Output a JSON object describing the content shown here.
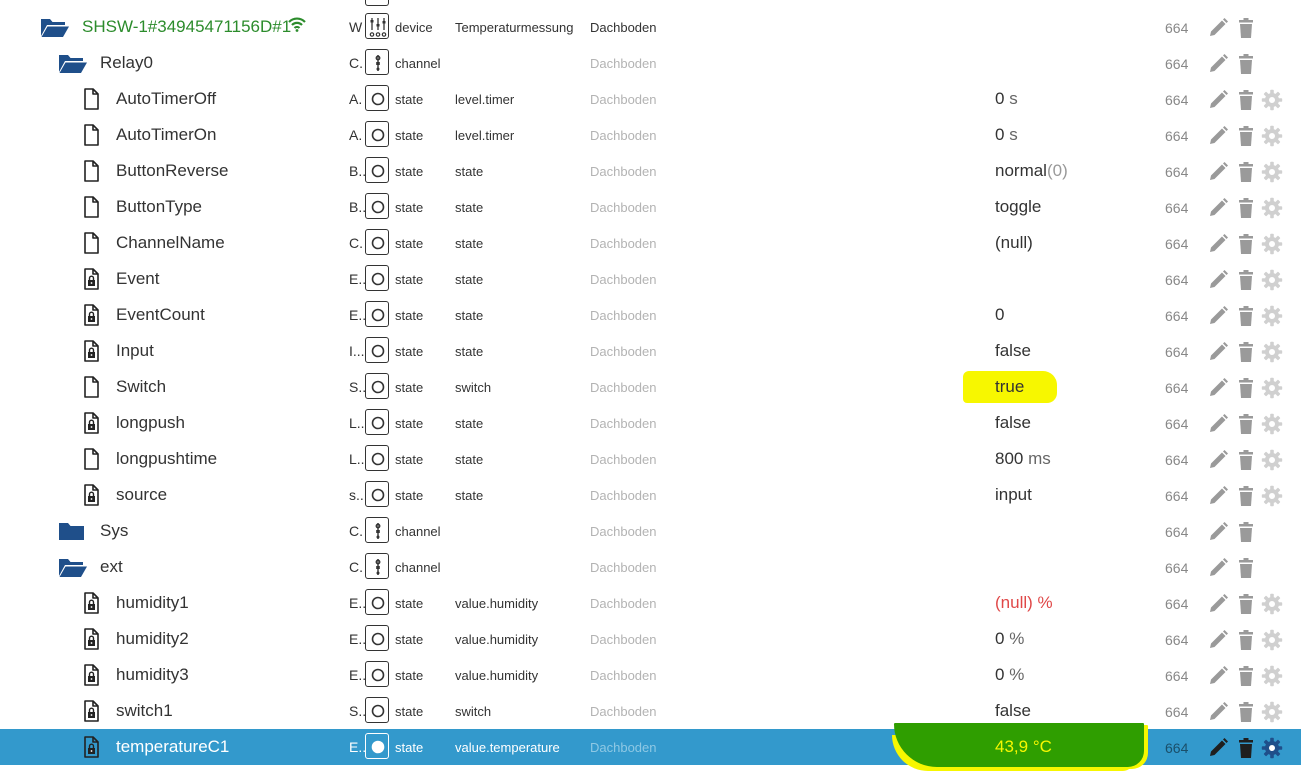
{
  "colors": {
    "folder": "#1f4f8a",
    "device_name": "#2c8c2c",
    "wifi": "#2c8c2c",
    "selected_row": "#3399cc",
    "error_value": "#e04848",
    "highlight_yellow": "#f7f700",
    "highlight_green": "#2f9e00",
    "action_icon": "#9a9a9a"
  },
  "rows": [
    {
      "icon": "folder-open-icon",
      "depth": 0,
      "name": "SHSW-1#34945471156D#1",
      "wifi": true,
      "role_abbr": "W",
      "type_icon": "device-icon",
      "type": "device",
      "role": "Temperaturmessung",
      "room": "Dachboden",
      "room_main": true,
      "value": "",
      "unit": "",
      "acl": "664",
      "gear": false
    },
    {
      "icon": "folder-open-icon",
      "depth": 1,
      "name": "Relay0",
      "role_abbr": "C.",
      "type_icon": "channel-icon",
      "type": "channel",
      "role": "",
      "room": "Dachboden",
      "value": "",
      "unit": "",
      "acl": "664",
      "gear": false
    },
    {
      "icon": "file-icon",
      "depth": 2,
      "name": "AutoTimerOff",
      "role_abbr": "A.",
      "type_icon": "state-icon",
      "type": "state",
      "role": "level.timer",
      "room": "Dachboden",
      "value": "0",
      "unit": " s",
      "acl": "664",
      "gear": true
    },
    {
      "icon": "file-icon",
      "depth": 2,
      "name": "AutoTimerOn",
      "role_abbr": "A.",
      "type_icon": "state-icon",
      "type": "state",
      "role": "level.timer",
      "room": "Dachboden",
      "value": "0",
      "unit": " s",
      "acl": "664",
      "gear": true
    },
    {
      "icon": "file-icon",
      "depth": 2,
      "name": "ButtonReverse",
      "role_abbr": "B..",
      "type_icon": "state-icon",
      "type": "state",
      "role": "state",
      "room": "Dachboden",
      "value": "normal",
      "unit": "(0)",
      "unit_paren": true,
      "acl": "664",
      "gear": true
    },
    {
      "icon": "file-icon",
      "depth": 2,
      "name": "ButtonType",
      "role_abbr": "B..",
      "type_icon": "state-icon",
      "type": "state",
      "role": "state",
      "room": "Dachboden",
      "value": "toggle",
      "unit": "",
      "acl": "664",
      "gear": true
    },
    {
      "icon": "file-icon",
      "depth": 2,
      "name": "ChannelName",
      "role_abbr": "C.",
      "type_icon": "state-icon",
      "type": "state",
      "role": "state",
      "room": "Dachboden",
      "value": "(null)",
      "unit": "",
      "acl": "664",
      "gear": true
    },
    {
      "icon": "file-lock-icon",
      "depth": 2,
      "name": "Event",
      "role_abbr": "E..",
      "type_icon": "state-icon",
      "type": "state",
      "role": "state",
      "room": "Dachboden",
      "value": "",
      "unit": "",
      "acl": "664",
      "gear": true
    },
    {
      "icon": "file-lock-icon",
      "depth": 2,
      "name": "EventCount",
      "role_abbr": "E..",
      "type_icon": "state-icon",
      "type": "state",
      "role": "state",
      "room": "Dachboden",
      "value": "0",
      "unit": "",
      "acl": "664",
      "gear": true
    },
    {
      "icon": "file-lock-icon",
      "depth": 2,
      "name": "Input",
      "role_abbr": "I...",
      "type_icon": "state-icon",
      "type": "state",
      "role": "state",
      "room": "Dachboden",
      "value": "false",
      "unit": "",
      "acl": "664",
      "gear": true
    },
    {
      "icon": "file-icon",
      "depth": 2,
      "name": "Switch",
      "role_abbr": "S..",
      "type_icon": "state-icon",
      "type": "state",
      "role": "switch",
      "room": "Dachboden",
      "value": "true",
      "unit": "",
      "highlight": "yellow",
      "acl": "664",
      "gear": true
    },
    {
      "icon": "file-lock-icon",
      "depth": 2,
      "name": "longpush",
      "role_abbr": "L..",
      "type_icon": "state-icon",
      "type": "state",
      "role": "state",
      "room": "Dachboden",
      "value": "false",
      "unit": "",
      "acl": "664",
      "gear": true
    },
    {
      "icon": "file-icon",
      "depth": 2,
      "name": "longpushtime",
      "role_abbr": "L..",
      "type_icon": "state-icon",
      "type": "state",
      "role": "state",
      "room": "Dachboden",
      "value": "800",
      "unit": " ms",
      "acl": "664",
      "gear": true
    },
    {
      "icon": "file-lock-icon",
      "depth": 2,
      "name": "source",
      "role_abbr": "s..",
      "type_icon": "state-icon",
      "type": "state",
      "role": "state",
      "room": "Dachboden",
      "value": "input",
      "unit": "",
      "acl": "664",
      "gear": true
    },
    {
      "icon": "folder-closed-icon",
      "depth": 1,
      "name": "Sys",
      "role_abbr": "C.",
      "type_icon": "channel-icon",
      "type": "channel",
      "role": "",
      "room": "Dachboden",
      "value": "",
      "unit": "",
      "acl": "664",
      "gear": false
    },
    {
      "icon": "folder-open-icon",
      "depth": 1,
      "name": "ext",
      "role_abbr": "C.",
      "type_icon": "channel-icon",
      "type": "channel",
      "role": "",
      "room": "Dachboden",
      "value": "",
      "unit": "",
      "acl": "664",
      "gear": false
    },
    {
      "icon": "file-lock-icon",
      "depth": 2,
      "name": "humidity1",
      "role_abbr": "E..",
      "type_icon": "state-icon",
      "type": "state",
      "role": "value.humidity",
      "room": "Dachboden",
      "value": "(null)",
      "unit": " %",
      "error": true,
      "acl": "664",
      "gear": true
    },
    {
      "icon": "file-lock-icon",
      "depth": 2,
      "name": "humidity2",
      "role_abbr": "E..",
      "type_icon": "state-icon",
      "type": "state",
      "role": "value.humidity",
      "room": "Dachboden",
      "value": "0",
      "unit": " %",
      "acl": "664",
      "gear": true
    },
    {
      "icon": "file-lock-icon",
      "depth": 2,
      "name": "humidity3",
      "role_abbr": "E..",
      "type_icon": "state-icon",
      "type": "state",
      "role": "value.humidity",
      "room": "Dachboden",
      "value": "0",
      "unit": " %",
      "acl": "664",
      "gear": true
    },
    {
      "icon": "file-lock-icon",
      "depth": 2,
      "name": "switch1",
      "role_abbr": "S..",
      "type_icon": "state-icon",
      "type": "state",
      "role": "switch",
      "room": "Dachboden",
      "value": "false",
      "unit": "",
      "acl": "664",
      "gear": true
    },
    {
      "icon": "file-lock-icon",
      "depth": 2,
      "name": "temperatureC1",
      "role_abbr": "E..",
      "type_icon": "state-icon",
      "type": "state",
      "role": "value.temperature",
      "room": "Dachboden",
      "value": "43,9",
      "unit": " °C",
      "selected": true,
      "highlight": "green",
      "acl": "664",
      "gear": true
    }
  ]
}
